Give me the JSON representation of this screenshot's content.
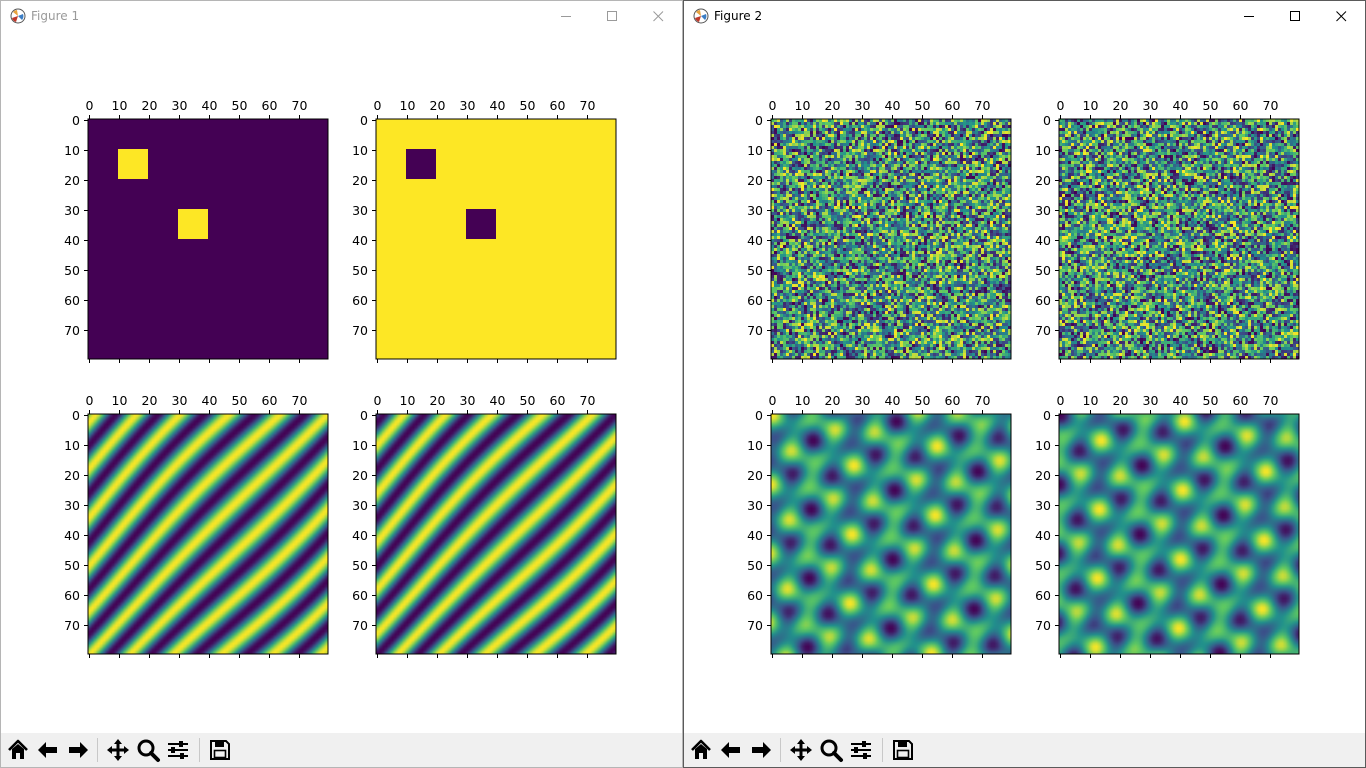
{
  "windows": [
    {
      "title": "Figure 1",
      "active": false,
      "subplots": [
        {
          "pattern": "squares",
          "invert": false
        },
        {
          "pattern": "squares",
          "invert": true
        },
        {
          "pattern": "stripes",
          "invert": false
        },
        {
          "pattern": "stripes",
          "invert": true
        }
      ]
    },
    {
      "title": "Figure 2",
      "active": true,
      "subplots": [
        {
          "pattern": "noise",
          "invert": false
        },
        {
          "pattern": "noise",
          "invert": false
        },
        {
          "pattern": "spots",
          "invert": false
        },
        {
          "pattern": "spots",
          "invert": true
        }
      ]
    }
  ],
  "axes": {
    "tick_values": [
      0,
      10,
      20,
      30,
      40,
      50,
      60,
      70
    ],
    "x_tick_labels": [
      "0",
      "10",
      "20",
      "30",
      "40",
      "50",
      "60",
      "70"
    ],
    "y_tick_labels": [
      "0",
      "10",
      "20",
      "30",
      "40",
      "50",
      "60",
      "70"
    ],
    "extent": [
      0,
      80
    ]
  },
  "toolbar_icons": [
    "home-icon",
    "back-icon",
    "forward-icon",
    "pan-icon",
    "zoom-icon",
    "configure-subplots-icon",
    "save-icon"
  ],
  "colors": {
    "viridis_low": "#440154",
    "viridis_mid": "#21918c",
    "viridis_high": "#fde725",
    "titlebar_inactive_text": "#9a9a9a",
    "toolbar_bg": "#f0f0f0"
  }
}
